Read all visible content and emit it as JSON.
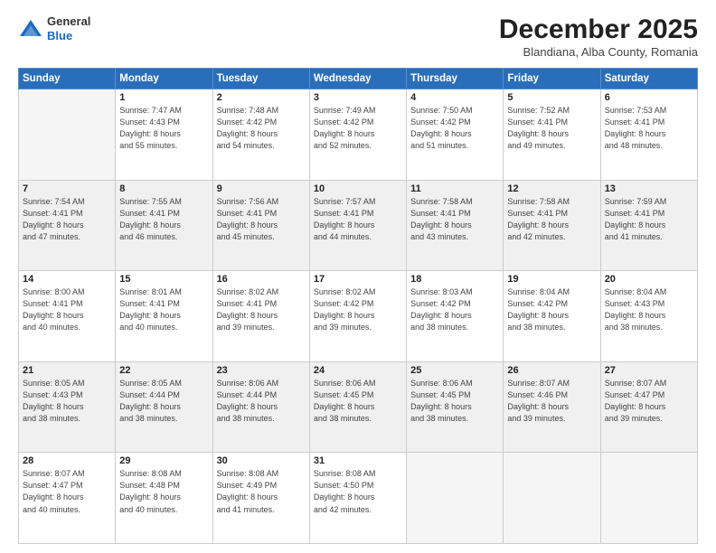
{
  "header": {
    "logo_line1": "General",
    "logo_line2": "Blue",
    "month": "December 2025",
    "location": "Blandiana, Alba County, Romania"
  },
  "days_of_week": [
    "Sunday",
    "Monday",
    "Tuesday",
    "Wednesday",
    "Thursday",
    "Friday",
    "Saturday"
  ],
  "weeks": [
    [
      {
        "day": "",
        "info": ""
      },
      {
        "day": "1",
        "info": "Sunrise: 7:47 AM\nSunset: 4:43 PM\nDaylight: 8 hours\nand 55 minutes."
      },
      {
        "day": "2",
        "info": "Sunrise: 7:48 AM\nSunset: 4:42 PM\nDaylight: 8 hours\nand 54 minutes."
      },
      {
        "day": "3",
        "info": "Sunrise: 7:49 AM\nSunset: 4:42 PM\nDaylight: 8 hours\nand 52 minutes."
      },
      {
        "day": "4",
        "info": "Sunrise: 7:50 AM\nSunset: 4:42 PM\nDaylight: 8 hours\nand 51 minutes."
      },
      {
        "day": "5",
        "info": "Sunrise: 7:52 AM\nSunset: 4:41 PM\nDaylight: 8 hours\nand 49 minutes."
      },
      {
        "day": "6",
        "info": "Sunrise: 7:53 AM\nSunset: 4:41 PM\nDaylight: 8 hours\nand 48 minutes."
      }
    ],
    [
      {
        "day": "7",
        "info": "Sunrise: 7:54 AM\nSunset: 4:41 PM\nDaylight: 8 hours\nand 47 minutes."
      },
      {
        "day": "8",
        "info": "Sunrise: 7:55 AM\nSunset: 4:41 PM\nDaylight: 8 hours\nand 46 minutes."
      },
      {
        "day": "9",
        "info": "Sunrise: 7:56 AM\nSunset: 4:41 PM\nDaylight: 8 hours\nand 45 minutes."
      },
      {
        "day": "10",
        "info": "Sunrise: 7:57 AM\nSunset: 4:41 PM\nDaylight: 8 hours\nand 44 minutes."
      },
      {
        "day": "11",
        "info": "Sunrise: 7:58 AM\nSunset: 4:41 PM\nDaylight: 8 hours\nand 43 minutes."
      },
      {
        "day": "12",
        "info": "Sunrise: 7:58 AM\nSunset: 4:41 PM\nDaylight: 8 hours\nand 42 minutes."
      },
      {
        "day": "13",
        "info": "Sunrise: 7:59 AM\nSunset: 4:41 PM\nDaylight: 8 hours\nand 41 minutes."
      }
    ],
    [
      {
        "day": "14",
        "info": "Sunrise: 8:00 AM\nSunset: 4:41 PM\nDaylight: 8 hours\nand 40 minutes."
      },
      {
        "day": "15",
        "info": "Sunrise: 8:01 AM\nSunset: 4:41 PM\nDaylight: 8 hours\nand 40 minutes."
      },
      {
        "day": "16",
        "info": "Sunrise: 8:02 AM\nSunset: 4:41 PM\nDaylight: 8 hours\nand 39 minutes."
      },
      {
        "day": "17",
        "info": "Sunrise: 8:02 AM\nSunset: 4:42 PM\nDaylight: 8 hours\nand 39 minutes."
      },
      {
        "day": "18",
        "info": "Sunrise: 8:03 AM\nSunset: 4:42 PM\nDaylight: 8 hours\nand 38 minutes."
      },
      {
        "day": "19",
        "info": "Sunrise: 8:04 AM\nSunset: 4:42 PM\nDaylight: 8 hours\nand 38 minutes."
      },
      {
        "day": "20",
        "info": "Sunrise: 8:04 AM\nSunset: 4:43 PM\nDaylight: 8 hours\nand 38 minutes."
      }
    ],
    [
      {
        "day": "21",
        "info": "Sunrise: 8:05 AM\nSunset: 4:43 PM\nDaylight: 8 hours\nand 38 minutes."
      },
      {
        "day": "22",
        "info": "Sunrise: 8:05 AM\nSunset: 4:44 PM\nDaylight: 8 hours\nand 38 minutes."
      },
      {
        "day": "23",
        "info": "Sunrise: 8:06 AM\nSunset: 4:44 PM\nDaylight: 8 hours\nand 38 minutes."
      },
      {
        "day": "24",
        "info": "Sunrise: 8:06 AM\nSunset: 4:45 PM\nDaylight: 8 hours\nand 38 minutes."
      },
      {
        "day": "25",
        "info": "Sunrise: 8:06 AM\nSunset: 4:45 PM\nDaylight: 8 hours\nand 38 minutes."
      },
      {
        "day": "26",
        "info": "Sunrise: 8:07 AM\nSunset: 4:46 PM\nDaylight: 8 hours\nand 39 minutes."
      },
      {
        "day": "27",
        "info": "Sunrise: 8:07 AM\nSunset: 4:47 PM\nDaylight: 8 hours\nand 39 minutes."
      }
    ],
    [
      {
        "day": "28",
        "info": "Sunrise: 8:07 AM\nSunset: 4:47 PM\nDaylight: 8 hours\nand 40 minutes."
      },
      {
        "day": "29",
        "info": "Sunrise: 8:08 AM\nSunset: 4:48 PM\nDaylight: 8 hours\nand 40 minutes."
      },
      {
        "day": "30",
        "info": "Sunrise: 8:08 AM\nSunset: 4:49 PM\nDaylight: 8 hours\nand 41 minutes."
      },
      {
        "day": "31",
        "info": "Sunrise: 8:08 AM\nSunset: 4:50 PM\nDaylight: 8 hours\nand 42 minutes."
      },
      {
        "day": "",
        "info": ""
      },
      {
        "day": "",
        "info": ""
      },
      {
        "day": "",
        "info": ""
      }
    ]
  ]
}
